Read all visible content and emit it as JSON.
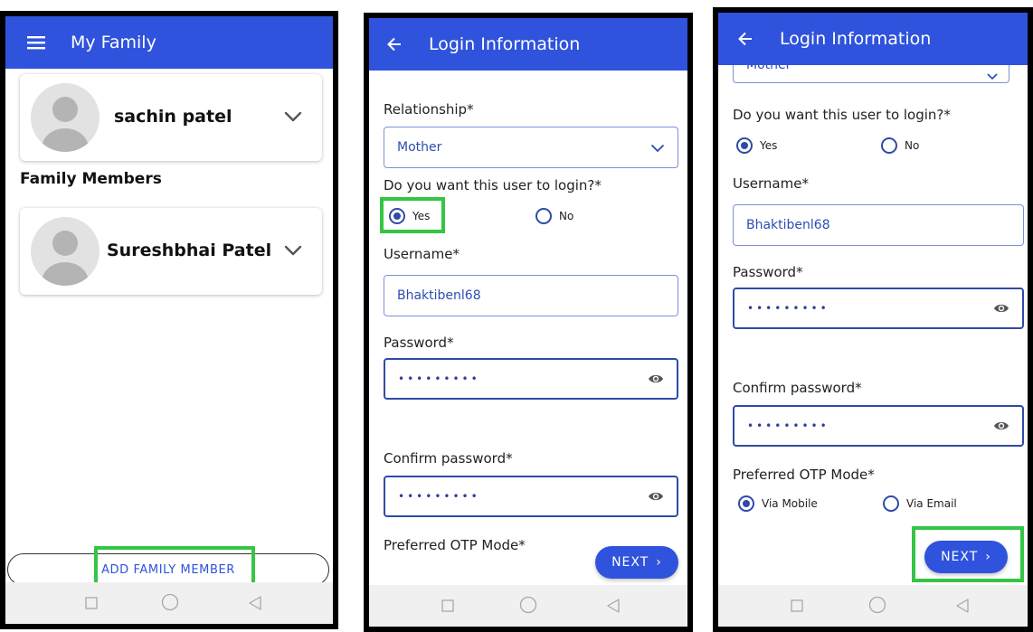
{
  "colors": {
    "primary": "#2f53dc",
    "highlight": "#35c545",
    "field_text": "#2f4db0"
  },
  "screen1": {
    "appbar": {
      "menu_icon": "hamburger-menu-icon",
      "title": "My Family"
    },
    "profile": {
      "name": "sachin patel",
      "expand_icon": "chevron-down-icon"
    },
    "section_title": "Family Members",
    "members": [
      {
        "name": "Sureshbhai Patel",
        "expand_icon": "chevron-down-icon"
      }
    ],
    "add_button": "ADD FAMILY MEMBER",
    "nav": [
      "square-recents-icon",
      "circle-home-icon",
      "triangle-back-icon"
    ]
  },
  "screen2": {
    "appbar": {
      "back_icon": "arrow-left-icon",
      "title": "Login Information"
    },
    "relationship": {
      "label": "Relationship*",
      "value": "Mother"
    },
    "login_question": "Do you want this user to login?*",
    "login_options": [
      {
        "label": "Yes",
        "selected": true
      },
      {
        "label": "No",
        "selected": false
      }
    ],
    "username": {
      "label": "Username*",
      "value": "Bhaktibenl68"
    },
    "password": {
      "label": "Password*",
      "value": "•••••••••"
    },
    "confirm_password": {
      "label": "Confirm password*",
      "value": "•••••••••"
    },
    "otp_label": "Preferred OTP Mode*",
    "next_button": "NEXT",
    "next_arrow": "›"
  },
  "screen3": {
    "appbar": {
      "back_icon": "arrow-left-icon",
      "title": "Login Information"
    },
    "relationship_value": "Mother",
    "login_question": "Do you want this user to login?*",
    "login_options": [
      {
        "label": "Yes",
        "selected": true
      },
      {
        "label": "No",
        "selected": false
      }
    ],
    "username": {
      "label": "Username*",
      "value": "Bhaktibenl68"
    },
    "password": {
      "label": "Password*",
      "value": "•••••••••"
    },
    "confirm_password": {
      "label": "Confirm password*",
      "value": "•••••••••"
    },
    "otp_label": "Preferred OTP Mode*",
    "otp_options": [
      {
        "label": "Via Mobile",
        "selected": true
      },
      {
        "label": "Via Email",
        "selected": false
      }
    ],
    "next_button": "NEXT",
    "next_arrow": "›"
  }
}
